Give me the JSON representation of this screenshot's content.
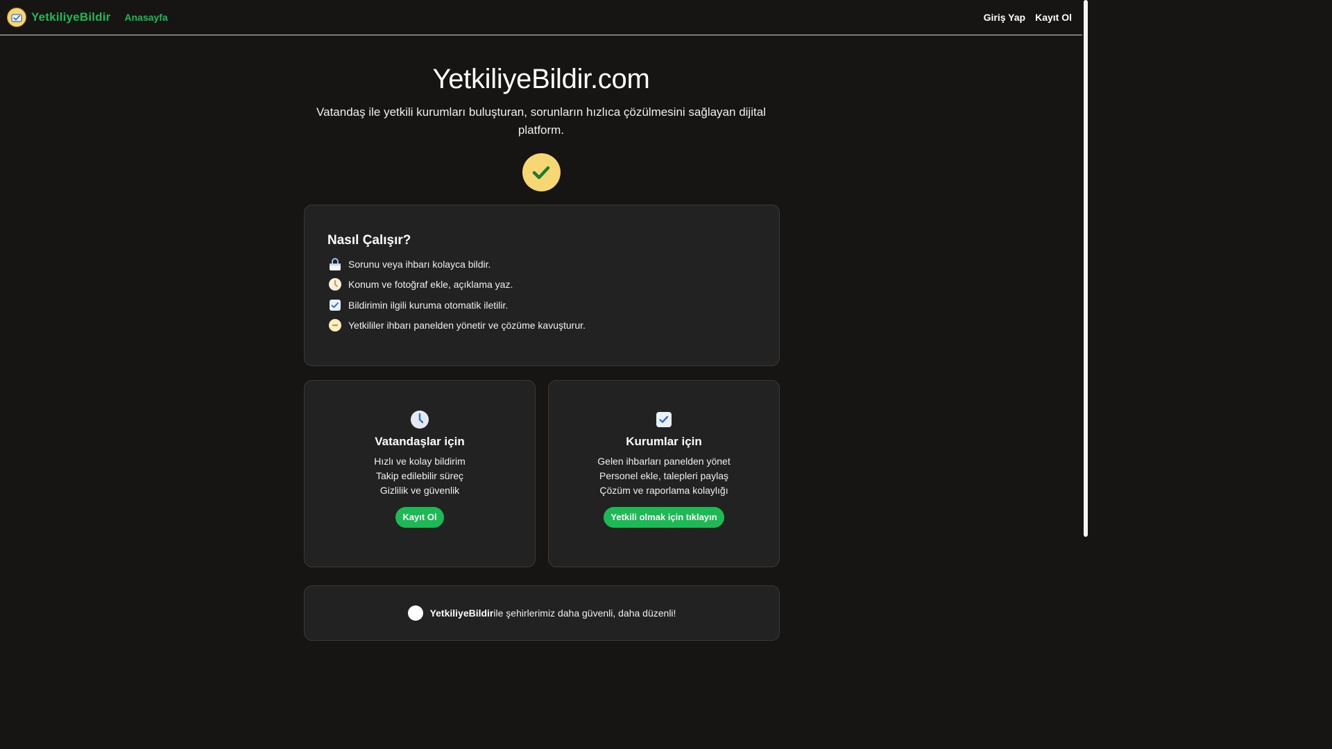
{
  "navbar": {
    "brand": "YetkiliyeBildir",
    "home": "Anasayfa",
    "login": "Giriş Yap",
    "register": "Kayıt Ol"
  },
  "hero": {
    "title": "YetkiliyeBildir.com",
    "subtitle": "Vatandaş ile yetkili kurumları buluşturan, sorunların hızlıca çözülmesini sağlayan dijital platform."
  },
  "how": {
    "title": "Nasıl Çalışır?",
    "steps": [
      {
        "icon": "lock-icon",
        "text": "Sorunu veya ihbarı kolayca bildir."
      },
      {
        "icon": "clock-icon",
        "text": "Konum ve fotoğraf ekle, açıklama yaz."
      },
      {
        "icon": "check-box-icon",
        "text": "Bildirimin ilgili kuruma otomatik iletilir."
      },
      {
        "icon": "minus-circle-icon",
        "text": "Yetkililer ihbarı panelden yönetir ve çözüme kavuşturur."
      }
    ]
  },
  "citizens": {
    "icon": "clock-icon",
    "title": "Vatandaşlar için",
    "items": [
      "Hızlı ve kolay bildirim",
      "Takip edilebilir süreç",
      "Gizlilik ve güvenlik"
    ],
    "button": "Kayıt Ol"
  },
  "institutions": {
    "icon": "check-box-icon",
    "title": "Kurumlar için",
    "items": [
      "Gelen ihbarları panelden yönet",
      "Personel ekle, talepleri paylaş",
      "Çözüm ve raporlama kolaylığı"
    ],
    "button": "Yetkili olmak için tıklayın"
  },
  "footer": {
    "brand": "YetkiliyeBildir",
    "text": " ile şehirlerimiz daha güvenli, daha düzenli!"
  },
  "colors": {
    "background": "#171514",
    "card": "#222222",
    "accent_green": "#1db954",
    "accent_yellow": "#f7d774"
  }
}
